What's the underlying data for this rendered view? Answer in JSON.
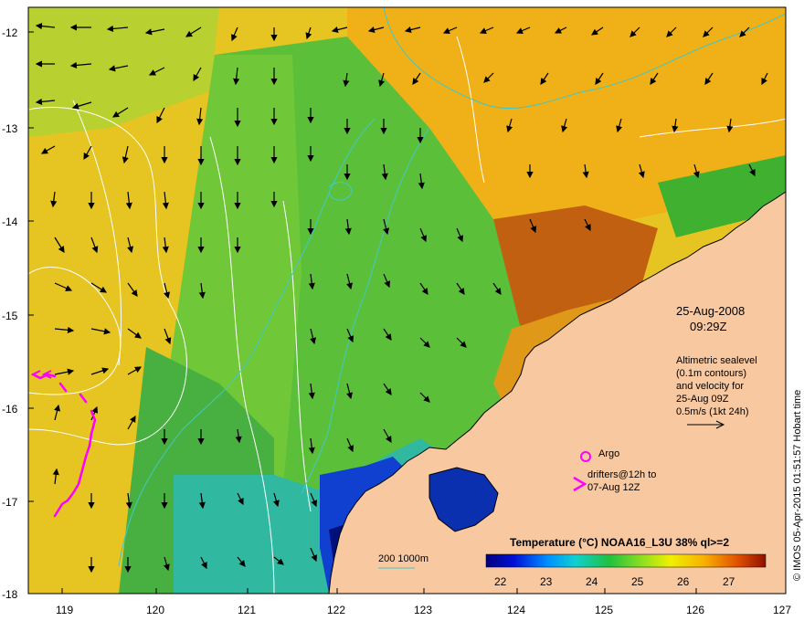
{
  "axes": {
    "y_ticks": [
      "-12",
      "-13",
      "-14",
      "-15",
      "-16",
      "-17",
      "-18"
    ],
    "x_ticks": [
      "119",
      "120",
      "121",
      "122",
      "123",
      "124",
      "125",
      "126",
      "127"
    ]
  },
  "annotations": {
    "date": "25-Aug-2008",
    "time": "09:29Z",
    "altimetry_lines": [
      "Altimetric sealevel",
      "(0.1m contours)",
      "and velocity for",
      "25-Aug 09Z",
      "0.5m/s (1kt 24h)"
    ],
    "argo_label": "Argo",
    "drifters_line1": "drifters@12h to",
    "drifters_line2": "07-Aug 12Z",
    "credit": "© IMOS 05-Apr-2015 01:51:57 Hobart time",
    "bathy_label": "200  1000m"
  },
  "colorbar": {
    "title": "Temperature (°C) NOAA16_L3U 38% ql>=2",
    "labels": [
      "22",
      "23",
      "24",
      "25",
      "26",
      "27"
    ]
  },
  "colors": {
    "land": "#f8c8a0",
    "coast": "#000000",
    "contour": "#ffffff",
    "bathymetry": "#40c8c8",
    "drifter": "#ff00ff"
  }
}
